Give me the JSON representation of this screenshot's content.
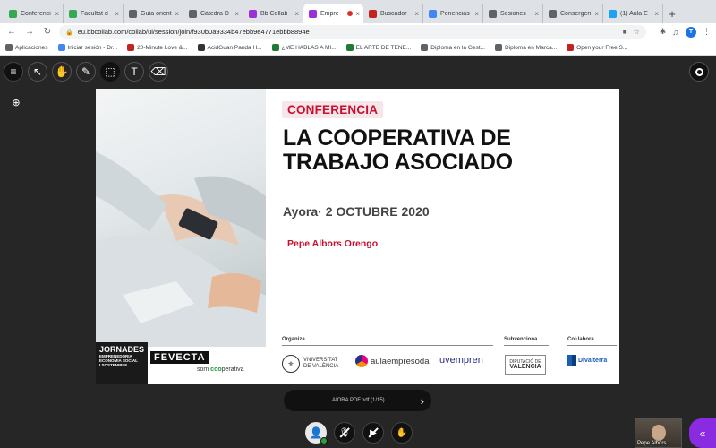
{
  "browser": {
    "tabs": [
      {
        "title": "Conferenci",
        "favicon_color": "#34a853",
        "active": false
      },
      {
        "title": "Facultat d",
        "favicon_color": "#34a853",
        "active": false
      },
      {
        "title": "Guía orient",
        "favicon_color": "#5f6368",
        "active": false
      },
      {
        "title": "Càtedra D",
        "favicon_color": "#5f6368",
        "active": false
      },
      {
        "title": "Bb Collab",
        "favicon_color": "#9b30d9",
        "active": false
      },
      {
        "title": "Empre",
        "favicon_color": "#9b30d9",
        "active": true,
        "recording": true
      },
      {
        "title": "Buscador",
        "favicon_color": "#c5221f",
        "active": false
      },
      {
        "title": "Ponencias",
        "favicon_color": "#4285f4",
        "active": false
      },
      {
        "title": "Sesiones",
        "favicon_color": "#5f6368",
        "active": false
      },
      {
        "title": "Consergeri",
        "favicon_color": "#5f6368",
        "active": false
      },
      {
        "title": "(1) Aula E",
        "favicon_color": "#1da1f2",
        "active": false
      }
    ],
    "url": "eu.bbcollab.com/collab/ui/session/join/f930b0a9334b47ebb9e4771ebbb8894e",
    "profile_initial": "T",
    "bookmarks": [
      {
        "label": "Aplicaciones",
        "color": "#5f6368"
      },
      {
        "label": "Iniciar sesión - Dr...",
        "color": "#4285f4"
      },
      {
        "label": "20-Minute Love &...",
        "color": "#c5221f"
      },
      {
        "label": "AcidGuan Panda H...",
        "color": "#333333"
      },
      {
        "label": "¿ME HABLAS A MI...",
        "color": "#1e7b34"
      },
      {
        "label": "EL ARTE DE TENE...",
        "color": "#1e7b34"
      },
      {
        "label": "Diploma en la Gest...",
        "color": "#5f6368"
      },
      {
        "label": "Diploma en Marca...",
        "color": "#5f6368"
      },
      {
        "label": "Open your Free S...",
        "color": "#c5221f"
      }
    ]
  },
  "slide": {
    "badge": "CONFERENCIA",
    "title_line1": "LA COOPERATIVA DE",
    "title_line2": "TRABAJO ASOCIADO",
    "date": "Ayora· 2 OCTUBRE 2020",
    "speaker": "Pepe Albors Orengo",
    "jornades_big": "JORNADES",
    "jornades_small_1": "EMPRENEDORIA",
    "jornades_small_2": "ECONOMIA SOCIAL",
    "jornades_small_3": "I SOSTENIBLE",
    "fevecta": "FEVECTA",
    "fevecta_sub_prefix": "som ",
    "fevecta_sub_coop": "coo",
    "fevecta_sub_suffix": "perativa",
    "section_organiza": "Organiza",
    "section_subvenciona": "Subvenciona",
    "section_colabora": "Col·labora",
    "logo_uv_1": "VNIVERSITAT",
    "logo_uv_2": "DE VALÈNCIA",
    "logo_aula": "aulaempresodal",
    "logo_uvempren": "uvempren",
    "logo_dipu_1": "DIPUTACIÓ DE",
    "logo_dipu_2": "VALÈNCIA",
    "logo_divalterra": "Divalterra"
  },
  "bottom": {
    "file_name": "AIORA PDF.pdf   (1/15)",
    "participant_name": "Pepe Albors..."
  }
}
